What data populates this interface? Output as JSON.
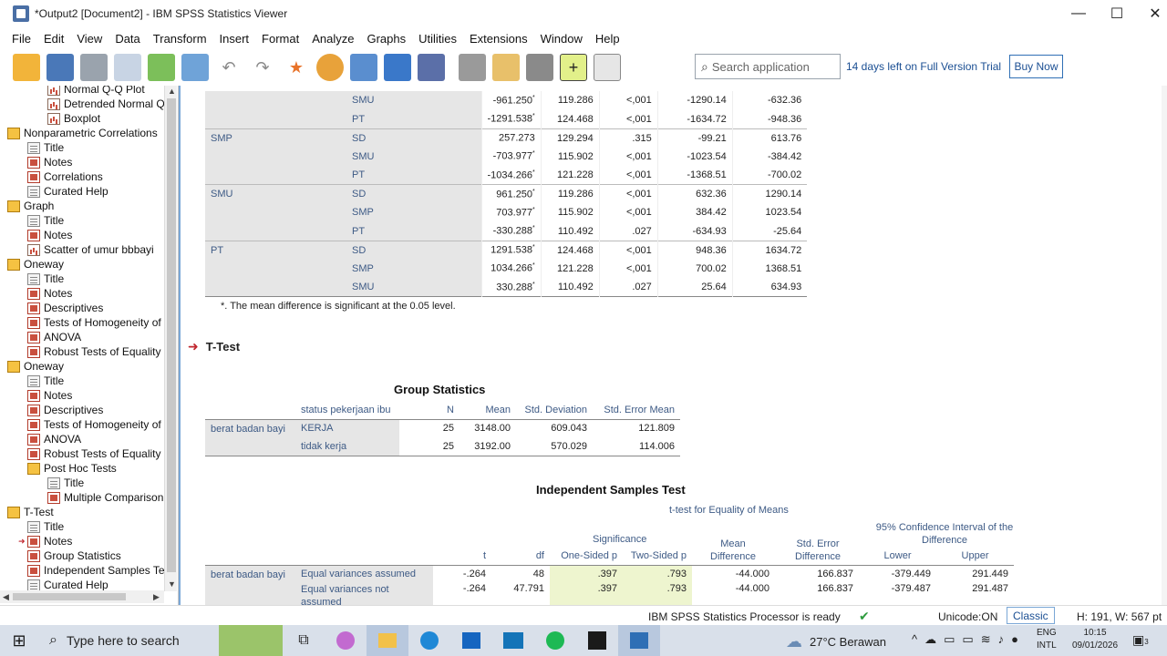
{
  "window": {
    "title": "*Output2 [Document2] - IBM SPSS Statistics Viewer",
    "minimize": "—",
    "maximize": "☐",
    "close": "✕"
  },
  "menu": [
    "File",
    "Edit",
    "View",
    "Data",
    "Transform",
    "Insert",
    "Format",
    "Analyze",
    "Graphs",
    "Utilities",
    "Extensions",
    "Window",
    "Help"
  ],
  "toolbar": {
    "search_placeholder": "Search application",
    "trial_text": "14 days left on Full Version Trial",
    "buy_label": "Buy Now"
  },
  "outline": [
    {
      "label": "Normal Q-Q Plot",
      "indent": 2,
      "icon": "chart"
    },
    {
      "label": "Detrended Normal Q",
      "indent": 2,
      "icon": "chart"
    },
    {
      "label": "Boxplot",
      "indent": 2,
      "icon": "chart"
    },
    {
      "label": "Nonparametric Correlations",
      "indent": 0,
      "icon": "book"
    },
    {
      "label": "Title",
      "indent": 1,
      "icon": "doc"
    },
    {
      "label": "Notes",
      "indent": 1,
      "icon": "red"
    },
    {
      "label": "Correlations",
      "indent": 1,
      "icon": "red"
    },
    {
      "label": "Curated Help",
      "indent": 1,
      "icon": "doc"
    },
    {
      "label": "Graph",
      "indent": 0,
      "icon": "book"
    },
    {
      "label": "Title",
      "indent": 1,
      "icon": "doc"
    },
    {
      "label": "Notes",
      "indent": 1,
      "icon": "red"
    },
    {
      "label": "Scatter of umur bbbayi",
      "indent": 1,
      "icon": "chart"
    },
    {
      "label": "Oneway",
      "indent": 0,
      "icon": "book"
    },
    {
      "label": "Title",
      "indent": 1,
      "icon": "doc"
    },
    {
      "label": "Notes",
      "indent": 1,
      "icon": "red"
    },
    {
      "label": "Descriptives",
      "indent": 1,
      "icon": "red"
    },
    {
      "label": "Tests of Homogeneity of V",
      "indent": 1,
      "icon": "red"
    },
    {
      "label": "ANOVA",
      "indent": 1,
      "icon": "red"
    },
    {
      "label": "Robust Tests of Equality o",
      "indent": 1,
      "icon": "red"
    },
    {
      "label": "Oneway",
      "indent": 0,
      "icon": "book"
    },
    {
      "label": "Title",
      "indent": 1,
      "icon": "doc"
    },
    {
      "label": "Notes",
      "indent": 1,
      "icon": "red"
    },
    {
      "label": "Descriptives",
      "indent": 1,
      "icon": "red"
    },
    {
      "label": "Tests of Homogeneity of V",
      "indent": 1,
      "icon": "red"
    },
    {
      "label": "ANOVA",
      "indent": 1,
      "icon": "red"
    },
    {
      "label": "Robust Tests of Equality o",
      "indent": 1,
      "icon": "red"
    },
    {
      "label": "Post Hoc Tests",
      "indent": 1,
      "icon": "book"
    },
    {
      "label": "Title",
      "indent": 2,
      "icon": "doc"
    },
    {
      "label": "Multiple Comparison",
      "indent": 2,
      "icon": "red"
    },
    {
      "label": "T-Test",
      "indent": 0,
      "icon": "book"
    },
    {
      "label": "Title",
      "indent": 1,
      "icon": "doc"
    },
    {
      "label": "Notes",
      "indent": 1,
      "icon": "red"
    },
    {
      "label": "Group Statistics",
      "indent": 1,
      "icon": "red"
    },
    {
      "label": "Independent Samples Te",
      "indent": 1,
      "icon": "red"
    },
    {
      "label": "Curated Help",
      "indent": 1,
      "icon": "doc"
    }
  ],
  "posthoc": {
    "rows": [
      {
        "g1": "",
        "g2": "SMU",
        "diff": "-961.250",
        "sig_mark": "*",
        "se": "119.286",
        "p": "<,001",
        "lo": "-1290.14",
        "hi": "-632.36"
      },
      {
        "g1": "",
        "g2": "PT",
        "diff": "-1291.538",
        "sig_mark": "*",
        "se": "124.468",
        "p": "<,001",
        "lo": "-1634.72",
        "hi": "-948.36"
      },
      {
        "g1": "SMP",
        "g2": "SD",
        "diff": "257.273",
        "sig_mark": "",
        "se": "129.294",
        "p": ".315",
        "lo": "-99.21",
        "hi": "613.76"
      },
      {
        "g1": "",
        "g2": "SMU",
        "diff": "-703.977",
        "sig_mark": "*",
        "se": "115.902",
        "p": "<,001",
        "lo": "-1023.54",
        "hi": "-384.42"
      },
      {
        "g1": "",
        "g2": "PT",
        "diff": "-1034.266",
        "sig_mark": "*",
        "se": "121.228",
        "p": "<,001",
        "lo": "-1368.51",
        "hi": "-700.02"
      },
      {
        "g1": "SMU",
        "g2": "SD",
        "diff": "961.250",
        "sig_mark": "*",
        "se": "119.286",
        "p": "<,001",
        "lo": "632.36",
        "hi": "1290.14"
      },
      {
        "g1": "",
        "g2": "SMP",
        "diff": "703.977",
        "sig_mark": "*",
        "se": "115.902",
        "p": "<,001",
        "lo": "384.42",
        "hi": "1023.54"
      },
      {
        "g1": "",
        "g2": "PT",
        "diff": "-330.288",
        "sig_mark": "*",
        "se": "110.492",
        "p": ".027",
        "lo": "-634.93",
        "hi": "-25.64"
      },
      {
        "g1": "PT",
        "g2": "SD",
        "diff": "1291.538",
        "sig_mark": "*",
        "se": "124.468",
        "p": "<,001",
        "lo": "948.36",
        "hi": "1634.72"
      },
      {
        "g1": "",
        "g2": "SMP",
        "diff": "1034.266",
        "sig_mark": "*",
        "se": "121.228",
        "p": "<,001",
        "lo": "700.02",
        "hi": "1368.51"
      },
      {
        "g1": "",
        "g2": "SMU",
        "diff": "330.288",
        "sig_mark": "*",
        "se": "110.492",
        "p": ".027",
        "lo": "25.64",
        "hi": "634.93"
      }
    ],
    "footnote": "*. The mean difference is significant at the 0.05 level."
  },
  "ttest_heading": "T-Test",
  "group_stats": {
    "title": "Group Statistics",
    "headers": [
      "status pekerjaan ibu",
      "N",
      "Mean",
      "Std. Deviation",
      "Std. Error Mean"
    ],
    "row_label": "berat badan bayi",
    "rows": [
      {
        "group": "KERJA",
        "n": "25",
        "mean": "3148.00",
        "sd": "609.043",
        "sem": "121.809"
      },
      {
        "group": "tidak kerja",
        "n": "25",
        "mean": "3192.00",
        "sd": "570.029",
        "sem": "114.006"
      }
    ]
  },
  "ind_test": {
    "title": "Independent Samples Test",
    "super_header": "t-test for Equality of Means",
    "sig_header": "Significance",
    "ci_header": "95% Confidence Interval of the Difference",
    "headers": {
      "t": "t",
      "df": "df",
      "one": "One-Sided p",
      "two": "Two-Sided p",
      "md": "Mean Difference",
      "sed": "Std. Error Difference",
      "lo": "Lower",
      "hi": "Upper"
    },
    "row_label": "berat badan bayi",
    "rows": [
      {
        "label": "Equal variances assumed",
        "t": "-.264",
        "df": "48",
        "one": ".397",
        "two": ".793",
        "md": "-44.000",
        "sed": "166.837",
        "lo": "-379.449",
        "hi": "291.449"
      },
      {
        "label": "Equal variances not assumed",
        "t": "-.264",
        "df": "47.791",
        "one": ".397",
        "two": ".793",
        "md": "-44.000",
        "sed": "166.837",
        "lo": "-379.487",
        "hi": "291.487"
      }
    ]
  },
  "status": {
    "processor": "IBM SPSS Statistics Processor is ready",
    "unicode": "Unicode:ON",
    "mode": "Classic",
    "dims": "H: 191, W: 567 pt"
  },
  "taskbar": {
    "search_placeholder": "Type here to search",
    "weather": "27°C  Berawan",
    "lang1": "ENG",
    "lang2": "INTL",
    "time": "10:15",
    "date": "09/01/2026",
    "notif_count": "3"
  }
}
